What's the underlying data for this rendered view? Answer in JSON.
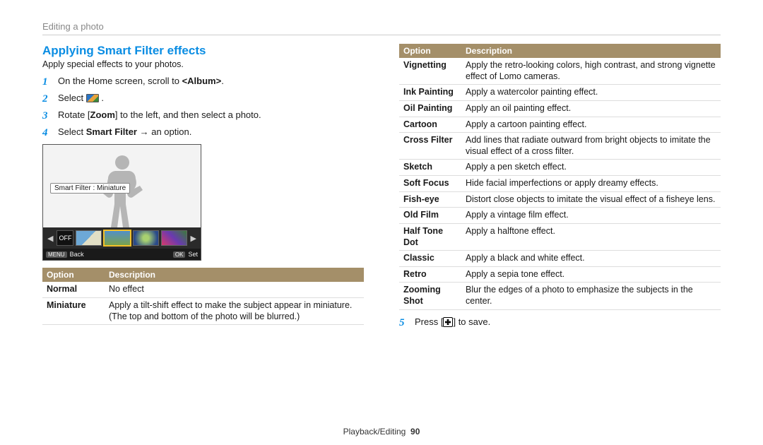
{
  "breadcrumb": "Editing a photo",
  "title": "Applying Smart Filter effects",
  "lead": "Apply special effects to your photos.",
  "steps": {
    "s1a": "On the Home screen, scroll to ",
    "s1b": "<Album>",
    "s1c": ".",
    "s2a": "Select ",
    "s2b": " .",
    "s3a": "Rotate [",
    "s3b": "Zoom",
    "s3c": "] to the left, and then select a photo.",
    "s4a": "Select ",
    "s4b": "Smart Filter",
    "s4c": " → an option.",
    "s5a": "Press [",
    "s5b": "] to save."
  },
  "screenshot": {
    "label": "Smart Filter : Miniature",
    "off": "OFF",
    "menu": "MENU",
    "back": "Back",
    "ok": "OK",
    "set": "Set"
  },
  "tableHeaders": {
    "option": "Option",
    "description": "Description"
  },
  "table1": [
    {
      "opt": "Normal",
      "desc": "No effect"
    },
    {
      "opt": "Miniature",
      "desc": "Apply a tilt-shift effect to make the subject appear in miniature. (The top and bottom of the photo will be blurred.)"
    }
  ],
  "table2": [
    {
      "opt": "Vignetting",
      "desc": "Apply the retro-looking colors, high contrast, and strong vignette effect of Lomo cameras."
    },
    {
      "opt": "Ink Painting",
      "desc": "Apply a watercolor painting effect."
    },
    {
      "opt": "Oil Painting",
      "desc": "Apply an oil painting effect."
    },
    {
      "opt": "Cartoon",
      "desc": "Apply a cartoon painting effect."
    },
    {
      "opt": "Cross Filter",
      "desc": "Add lines that radiate outward from bright objects to imitate the visual effect of a cross filter."
    },
    {
      "opt": "Sketch",
      "desc": "Apply a pen sketch effect."
    },
    {
      "opt": "Soft Focus",
      "desc": "Hide facial imperfections or apply dreamy effects."
    },
    {
      "opt": "Fish-eye",
      "desc": "Distort close objects to imitate the visual effect of a fisheye lens."
    },
    {
      "opt": "Old Film",
      "desc": "Apply a vintage film effect."
    },
    {
      "opt": "Half Tone Dot",
      "desc": "Apply a halftone effect."
    },
    {
      "opt": "Classic",
      "desc": "Apply a black and white effect."
    },
    {
      "opt": "Retro",
      "desc": "Apply a sepia tone effect."
    },
    {
      "opt": "Zooming Shot",
      "desc": "Blur the edges of a photo to emphasize the subjects in the center."
    }
  ],
  "footer": {
    "section": "Playback/Editing",
    "page": "90"
  }
}
